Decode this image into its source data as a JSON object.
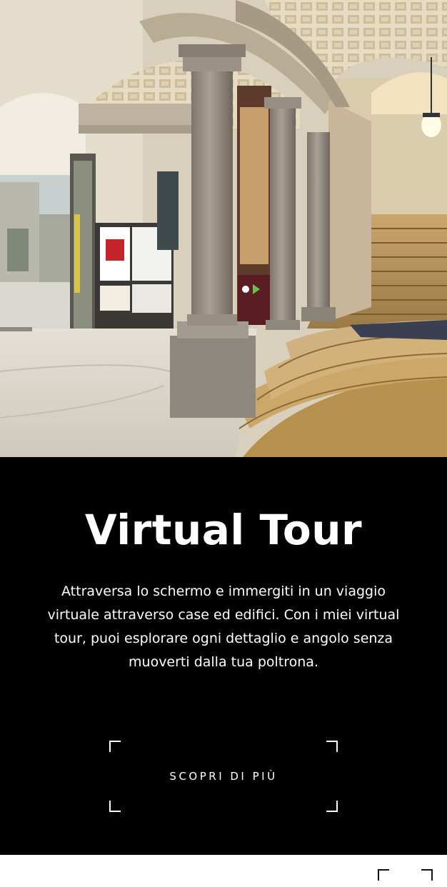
{
  "hero": {
    "image_icon": "panorama-photo"
  },
  "section": {
    "title": "Virtual Tour",
    "description": "Attraversa lo schermo e immergiti in un viaggio virtuale attraverso case ed edifici. Con i miei virtual tour, puoi esplorare ogni dettaglio e angolo senza muoverti dalla tua poltrona.",
    "cta_label": "SCOPRI DI PIÙ",
    "background_color": "#000000",
    "text_color": "#ffffff"
  }
}
